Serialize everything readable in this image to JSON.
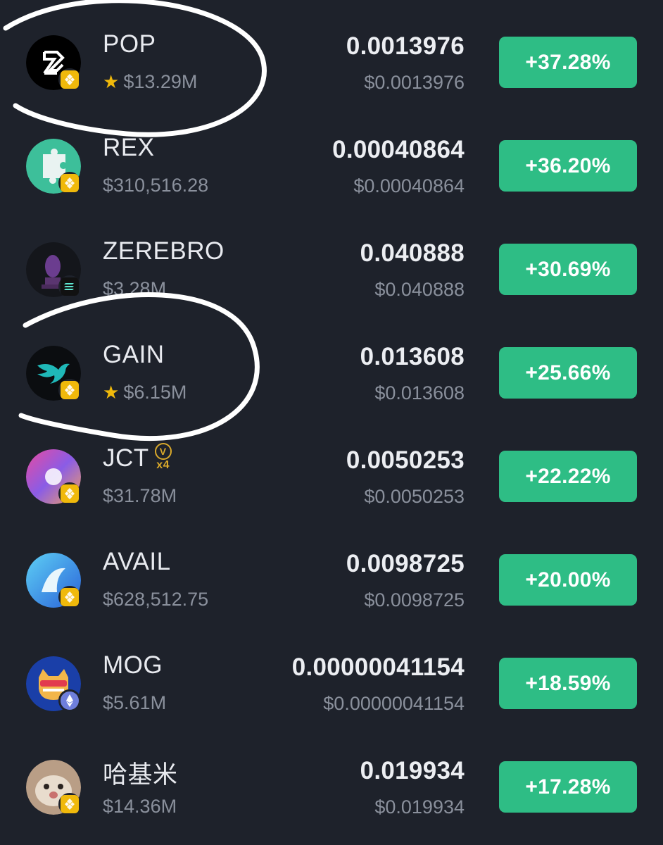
{
  "tokens": [
    {
      "symbol": "POP",
      "volume": "$13.29M",
      "starred": true,
      "price": "0.0013976",
      "price_usd": "$0.0013976",
      "change": "+37.28%",
      "chain": "bnb-icon",
      "logo": "pop-logo"
    },
    {
      "symbol": "REX",
      "volume": "$310,516.28",
      "starred": false,
      "price": "0.00040864",
      "price_usd": "$0.00040864",
      "change": "+36.20%",
      "chain": "bnb-icon",
      "logo": "rex-logo"
    },
    {
      "symbol": "ZEREBRO",
      "volume": "$3.28M",
      "starred": false,
      "price": "0.040888",
      "price_usd": "$0.040888",
      "change": "+30.69%",
      "chain": "solana-icon",
      "logo": "zerebro-logo"
    },
    {
      "symbol": "GAIN",
      "volume": "$6.15M",
      "starred": true,
      "price": "0.013608",
      "price_usd": "$0.013608",
      "change": "+25.66%",
      "chain": "bnb-icon",
      "logo": "gain-logo"
    },
    {
      "symbol": "JCT",
      "volume": "$31.78M",
      "starred": false,
      "price": "0.0050253",
      "price_usd": "$0.0050253",
      "change": "+22.22%",
      "chain": "bnb-icon",
      "logo": "jct-logo",
      "tag_letter": "V",
      "tag_multiplier": "x4"
    },
    {
      "symbol": "AVAIL",
      "volume": "$628,512.75",
      "starred": false,
      "price": "0.0098725",
      "price_usd": "$0.0098725",
      "change": "+20.00%",
      "chain": "bnb-icon",
      "logo": "avail-logo"
    },
    {
      "symbol": "MOG",
      "volume": "$5.61M",
      "starred": false,
      "price": "0.00000041154",
      "price_usd": "$0.00000041154",
      "change": "+18.59%",
      "chain": "ethereum-icon",
      "logo": "mog-logo"
    },
    {
      "symbol": "哈基米",
      "volume": "$14.36M",
      "starred": false,
      "price": "0.019934",
      "price_usd": "$0.019934",
      "change": "+17.28%",
      "chain": "bnb-icon",
      "logo": "hajimi-logo"
    }
  ],
  "colors": {
    "background": "#1e222b",
    "positive": "#2ebd85",
    "star": "#f0b90b",
    "bnb": "#f0b90b",
    "muted": "#8a909c"
  }
}
